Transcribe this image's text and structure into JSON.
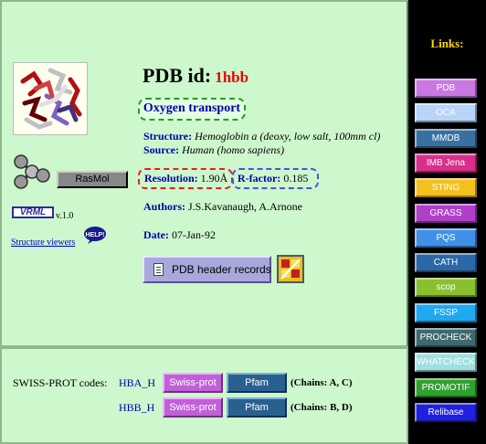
{
  "pdb": {
    "label": "PDB id:",
    "id": "1hbb"
  },
  "classification": "Oxygen transport",
  "structure": {
    "label": "Structure:",
    "value": "Hemoglobin a (deoxy, low salt, 100mm cl)"
  },
  "source": {
    "label": "Source:",
    "value": "Human (homo sapiens)"
  },
  "resolution": {
    "label": "Resolution:",
    "value": "1.90Å"
  },
  "rfactor": {
    "label": "R-factor:",
    "value": "0.185"
  },
  "authors": {
    "label": "Authors:",
    "value": "J.S.Kavanaugh, A.Arnone"
  },
  "date": {
    "label": "Date:",
    "value": "07-Jan-92"
  },
  "tools": {
    "rasmol_label": "RasMol",
    "vrml_logo": "VRML",
    "vrml_version": "v.1.0",
    "viewers_link": "Structure viewers",
    "help_label": "HELP!"
  },
  "header_button": "PDB header records",
  "swissprot": {
    "label": "SWISS-PROT codes:",
    "rows": [
      {
        "code": "HBA_H",
        "swiss": "Swiss-prot",
        "pfam": "Pfam",
        "chains": "(Chains: A, C)"
      },
      {
        "code": "HBB_H",
        "swiss": "Swiss-prot",
        "pfam": "Pfam",
        "chains": "(Chains: B, D)"
      }
    ]
  },
  "links": {
    "title": "Links:",
    "items": [
      {
        "label": "PDB",
        "color": "#c878e0"
      },
      {
        "label": "OCA",
        "color": "#b8d4f8"
      },
      {
        "label": "MMDB",
        "color": "#3a70a0"
      },
      {
        "label": "IMB Jena",
        "color": "#d8308a"
      },
      {
        "label": "STING",
        "color": "#f4c020"
      },
      {
        "label": "GRASS",
        "color": "#b040c8"
      },
      {
        "label": "PQS",
        "color": "#4090e8"
      },
      {
        "label": "CATH",
        "color": "#2a68a8"
      },
      {
        "label": "scop",
        "color": "#88c030"
      },
      {
        "label": "FSSP",
        "color": "#20a8f0"
      },
      {
        "label": "PROCHECK",
        "color": "#3e6a6e"
      },
      {
        "label": "WHATCHECK",
        "color": "#a0e0e0"
      },
      {
        "label": "PROMOTIF",
        "color": "#30a030"
      },
      {
        "label": "Relibase",
        "color": "#2020e0"
      }
    ]
  }
}
